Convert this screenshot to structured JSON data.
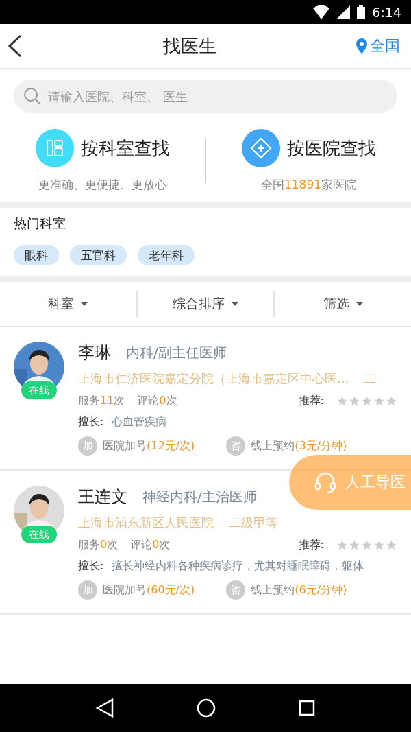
{
  "status_bar": {
    "time": "6:14"
  },
  "nav": {
    "title": "找医生",
    "location": "全国"
  },
  "search": {
    "placeholder": "请输入医院、科室、 医生"
  },
  "entries": [
    {
      "kind": "department",
      "title": "按科室查找",
      "subtitle": "更准确、更便捷、更放心"
    },
    {
      "kind": "hospital",
      "title": "按医院查找",
      "prefix": "全国",
      "count": "11891",
      "suffix": "家医院"
    }
  ],
  "hot": {
    "title": "热门科室",
    "tags": [
      "眼科",
      "五官科",
      "老年科"
    ]
  },
  "filters": [
    "科室",
    "综合排序",
    "筛选"
  ],
  "doctors": [
    {
      "name": "李琳",
      "title": "内科/副主任医师",
      "online": true,
      "status": "在线",
      "hospital": "上海市仁济医院嘉定分院（上海市嘉定区中心医...",
      "grade": "二",
      "service_label": "服务",
      "service_count": "11",
      "service_unit": "次",
      "review_label": "评论",
      "review_count": "0",
      "review_unit": "次",
      "rec_label": "推荐:",
      "stars": 0,
      "skill_label": "擅长:",
      "skill": "心血管疾病",
      "add_badge": "加",
      "add_label": "医院加号",
      "add_price": "(12元/次)",
      "consult_badge": "咨",
      "consult_label": "线上预约",
      "consult_price": "(3元/分钟)"
    },
    {
      "name": "王连文",
      "title": "神经内科/主治医师",
      "online": true,
      "status": "在线",
      "hospital": "上海市浦东新区人民医院",
      "grade": "二级甲等",
      "service_label": "服务",
      "service_count": "0",
      "service_unit": "次",
      "review_label": "评论",
      "review_count": "0",
      "review_unit": "次",
      "rec_label": "推荐:",
      "stars": 0,
      "skill_label": "擅长:",
      "skill": "擅长神经内科各种疾病诊疗，尤其对睡眠障碍，躯体",
      "add_badge": "加",
      "add_label": "医院加号",
      "add_price": "(60元/次)",
      "consult_badge": "咨",
      "consult_label": "线上预约",
      "consult_price": "(6元/分钟)"
    }
  ],
  "float_button": {
    "label": "人工导医"
  }
}
